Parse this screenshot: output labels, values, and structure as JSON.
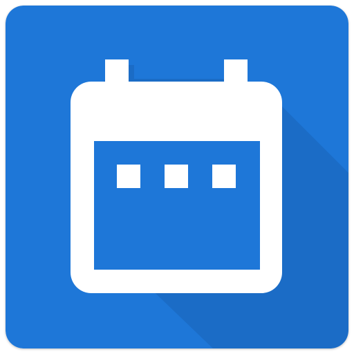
{
  "icon": {
    "name": "calendar-app-icon",
    "background_color": "#1e77d8",
    "shadow_color": "#1a64b8",
    "glyph_color": "#ffffff",
    "glyph": "calendar-icon"
  }
}
